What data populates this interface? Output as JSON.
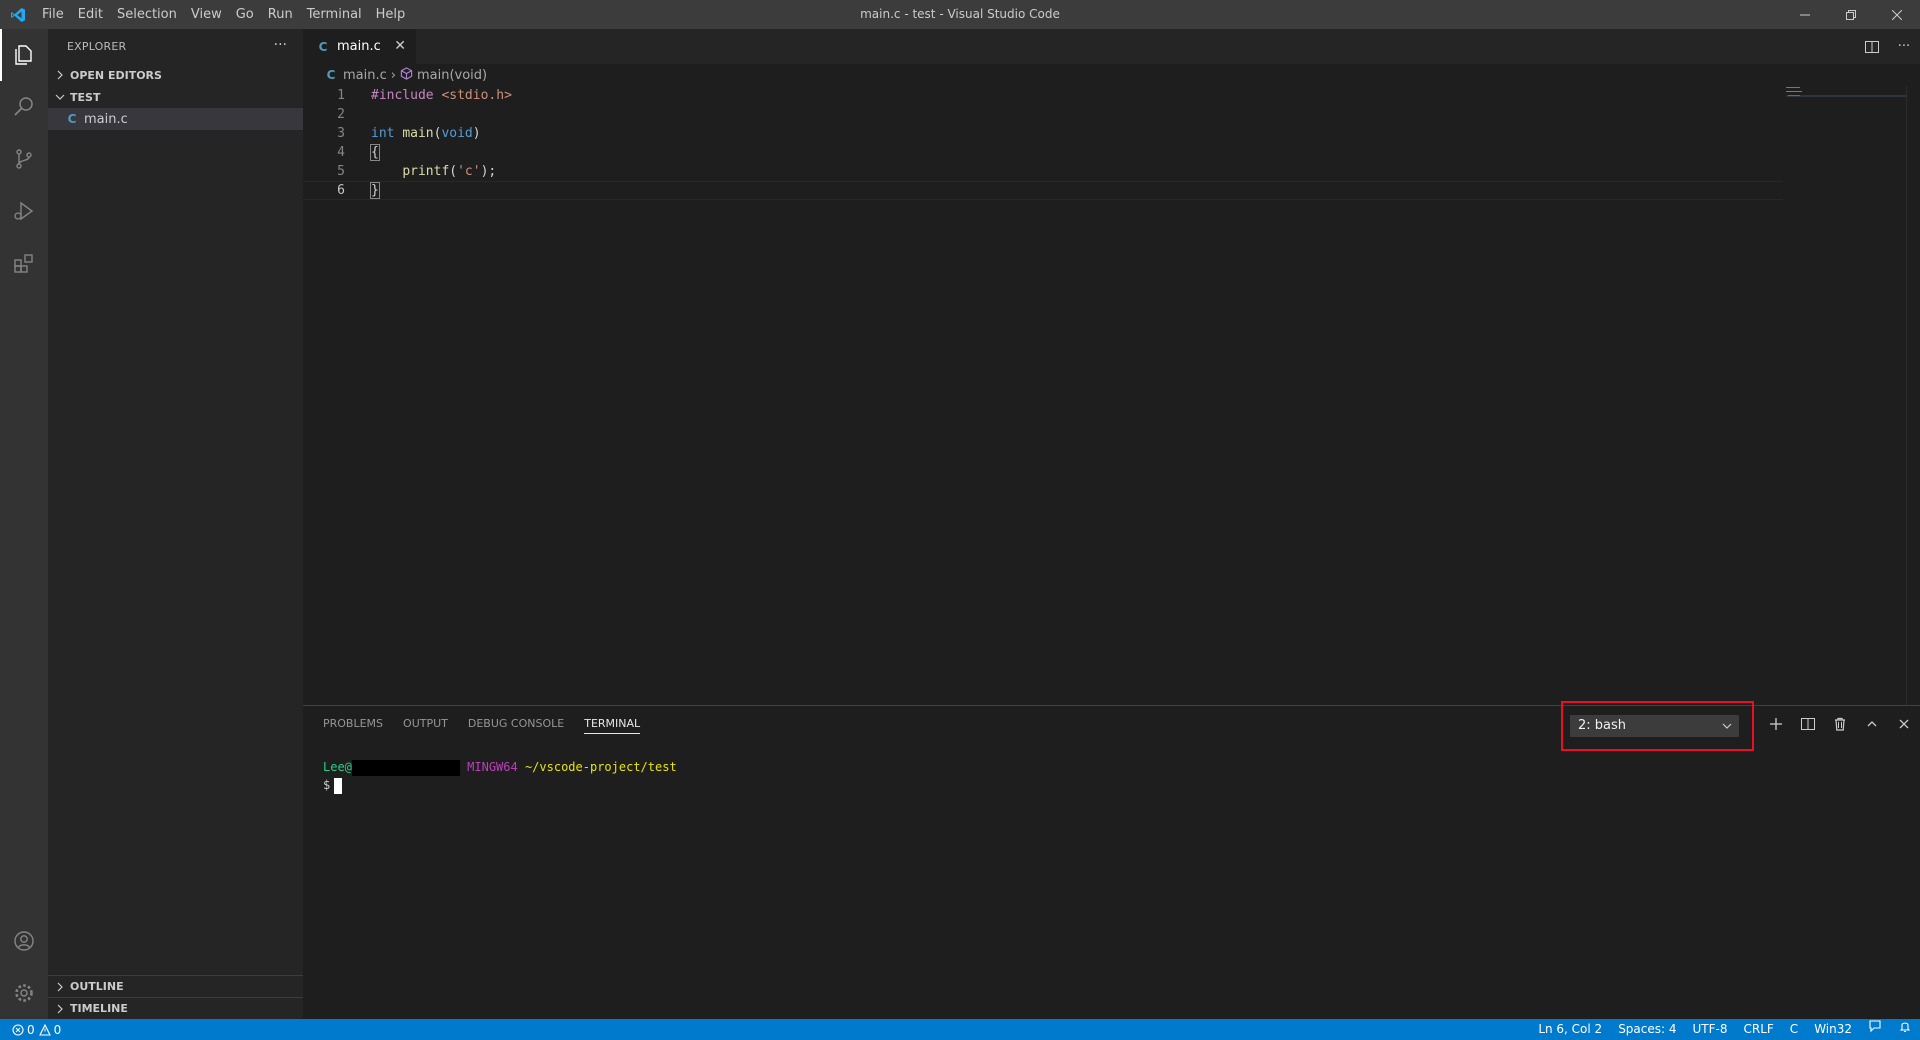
{
  "window": {
    "title": "main.c - test - Visual Studio Code",
    "menu": [
      "File",
      "Edit",
      "Selection",
      "View",
      "Go",
      "Run",
      "Terminal",
      "Help"
    ]
  },
  "sidebar": {
    "title": "EXPLORER",
    "open_editors": "OPEN EDITORS",
    "folder": "TEST",
    "files": [
      {
        "name": "main.c",
        "icon": "C"
      }
    ],
    "outline": "OUTLINE",
    "timeline": "TIMELINE"
  },
  "editor": {
    "tab": {
      "icon": "C",
      "label": "main.c"
    },
    "breadcrumb": {
      "file": "main.c",
      "symbol": "main(void)"
    },
    "lines": [
      {
        "num": "1",
        "include": "#include",
        "header": "<stdio.h>"
      },
      {
        "num": "2"
      },
      {
        "num": "3",
        "type": "int",
        "fn": "main",
        "param": "void"
      },
      {
        "num": "4",
        "brace": "{"
      },
      {
        "num": "5",
        "call": "printf",
        "arg": "'c'"
      },
      {
        "num": "6",
        "brace": "}"
      }
    ]
  },
  "panel": {
    "tabs": [
      "PROBLEMS",
      "OUTPUT",
      "DEBUG CONSOLE",
      "TERMINAL"
    ],
    "active_tab": "TERMINAL",
    "terminal_select": "2: bash",
    "terminal": {
      "user": "Lee@",
      "system": "MINGW64",
      "path": "~/vscode-project/test",
      "prompt": "$"
    }
  },
  "statusbar": {
    "errors": "0",
    "warnings": "0",
    "position": "Ln 6, Col 2",
    "indent": "Spaces: 4",
    "encoding": "UTF-8",
    "eol": "CRLF",
    "language": "C",
    "platform": "Win32"
  },
  "colors": {
    "accent": "#007acc",
    "highlight_box": "#e81123"
  }
}
